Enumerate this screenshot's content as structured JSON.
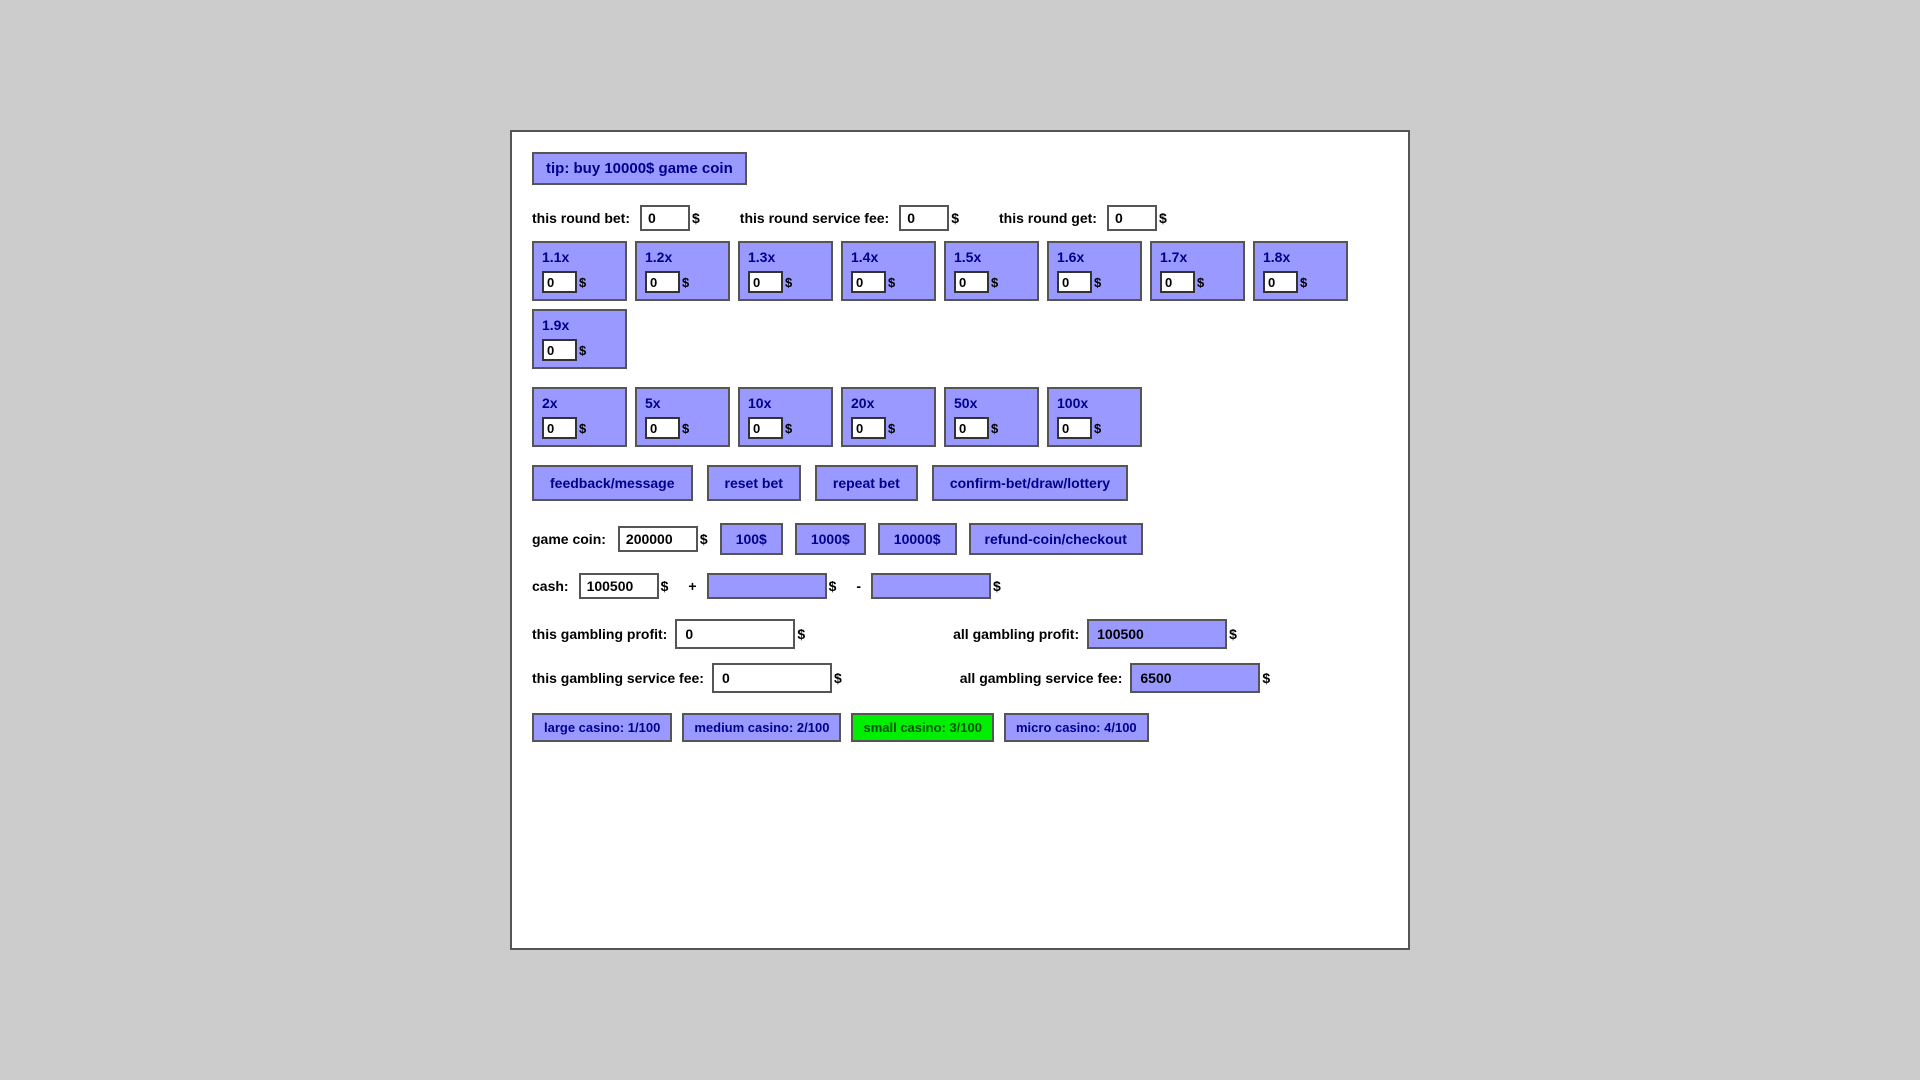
{
  "tip": {
    "text": "tip: buy 10000$ game coin"
  },
  "round": {
    "bet_label": "this round bet:",
    "bet_value": "0",
    "fee_label": "this round service fee:",
    "fee_value": "0",
    "get_label": "this round get:",
    "get_value": "0"
  },
  "multipliers_row1": [
    {
      "label": "1.1x",
      "value": "0"
    },
    {
      "label": "1.2x",
      "value": "0"
    },
    {
      "label": "1.3x",
      "value": "0"
    },
    {
      "label": "1.4x",
      "value": "0"
    },
    {
      "label": "1.5x",
      "value": "0"
    },
    {
      "label": "1.6x",
      "value": "0"
    },
    {
      "label": "1.7x",
      "value": "0"
    },
    {
      "label": "1.8x",
      "value": "0"
    },
    {
      "label": "1.9x",
      "value": "0"
    }
  ],
  "multipliers_row2": [
    {
      "label": "2x",
      "value": "0"
    },
    {
      "label": "5x",
      "value": "0"
    },
    {
      "label": "10x",
      "value": "0"
    },
    {
      "label": "20x",
      "value": "0"
    },
    {
      "label": "50x",
      "value": "0"
    },
    {
      "label": "100x",
      "value": "0"
    }
  ],
  "actions": {
    "feedback": "feedback/message",
    "reset": "reset bet",
    "repeat": "repeat bet",
    "confirm": "confirm-bet/draw/lottery"
  },
  "game_coin": {
    "label": "game coin:",
    "value": "200000",
    "btn100": "100$",
    "btn1000": "1000$",
    "btn10000": "10000$",
    "refund": "refund-coin/checkout"
  },
  "cash": {
    "label": "cash:",
    "value": "100500",
    "plus_sign": "+",
    "minus_sign": "-"
  },
  "profit": {
    "this_label": "this gambling profit:",
    "this_value": "0",
    "all_label": "all gambling profit:",
    "all_value": "100500"
  },
  "service_fee": {
    "this_label": "this gambling service fee:",
    "this_value": "0",
    "all_label": "all gambling service fee:",
    "all_value": "6500"
  },
  "casinos": [
    {
      "label": "large casino: 1/100",
      "type": "normal"
    },
    {
      "label": "medium casino: 2/100",
      "type": "normal"
    },
    {
      "label": "small casino: 3/100",
      "type": "green"
    },
    {
      "label": "micro casino: 4/100",
      "type": "normal"
    }
  ],
  "dollar": "$"
}
